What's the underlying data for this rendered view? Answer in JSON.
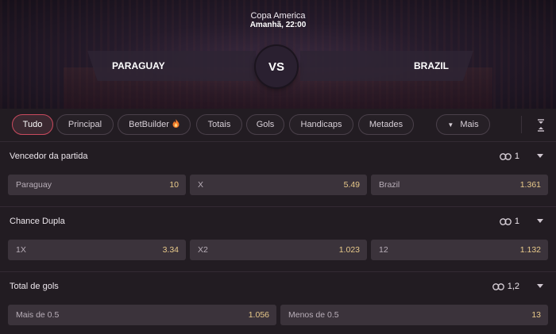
{
  "event": {
    "competition": "Copa America",
    "datetime": "Amanhã, 22:00",
    "home_team": "PARAGUAY",
    "away_team": "BRAZIL",
    "vs": "VS"
  },
  "tabs": [
    {
      "label": "Tudo",
      "active": true
    },
    {
      "label": "Principal"
    },
    {
      "label": "BetBuilder",
      "icon": "flame-icon"
    },
    {
      "label": "Totais"
    },
    {
      "label": "Gols"
    },
    {
      "label": "Handicaps"
    },
    {
      "label": "Metades"
    },
    {
      "label": "Mais",
      "icon": "caret-down-icon"
    }
  ],
  "markets": [
    {
      "title": "Vencedor da partida",
      "link_count": "1",
      "odds": [
        {
          "label": "Paraguay",
          "value": "10"
        },
        {
          "label": "X",
          "value": "5.49"
        },
        {
          "label": "Brazil",
          "value": "1.361"
        }
      ]
    },
    {
      "title": "Chance Dupla",
      "link_count": "1",
      "odds": [
        {
          "label": "1X",
          "value": "3.34"
        },
        {
          "label": "X2",
          "value": "1.023"
        },
        {
          "label": "12",
          "value": "1.132"
        }
      ]
    },
    {
      "title": "Total de gols",
      "link_count": "1,2",
      "odds": [
        {
          "label": "Mais de 0.5",
          "value": "1.056"
        },
        {
          "label": "Menos de 0.5",
          "value": "13"
        }
      ]
    }
  ],
  "colors": {
    "background": "#221c22",
    "odd_button": "#3b333b",
    "odd_value": "#e8c98a",
    "active_tab_border": "#c94a5e",
    "flame": "#f27b2a"
  }
}
